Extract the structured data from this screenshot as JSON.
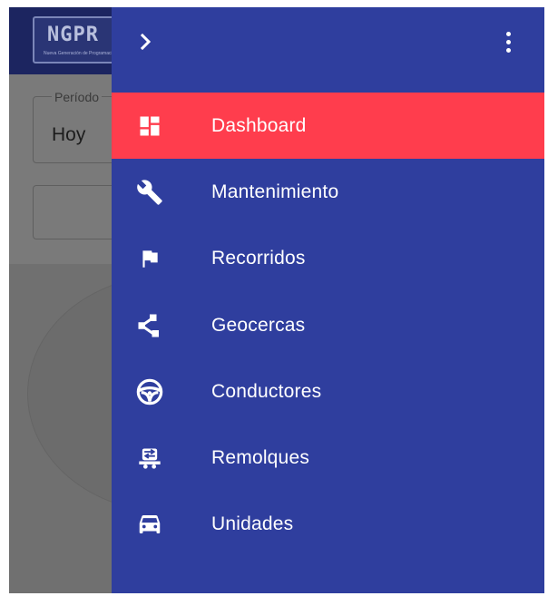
{
  "background": {
    "logo_text": "NGPR",
    "logo_subtitle": "Nueva Generación de Programación",
    "period": {
      "label": "Período",
      "value": "Hoy"
    }
  },
  "drawer": {
    "menu": [
      {
        "label": "Dashboard",
        "icon": "dashboard-icon",
        "active": true
      },
      {
        "label": "Mantenimiento",
        "icon": "wrench-icon",
        "active": false
      },
      {
        "label": "Recorridos",
        "icon": "flag-icon",
        "active": false
      },
      {
        "label": "Geocercas",
        "icon": "geofence-icon",
        "active": false
      },
      {
        "label": "Conductores",
        "icon": "steering-wheel-icon",
        "active": false
      },
      {
        "label": "Remolques",
        "icon": "trailer-icon",
        "active": false
      },
      {
        "label": "Unidades",
        "icon": "car-icon",
        "active": false
      }
    ]
  },
  "colors": {
    "drawer_bg": "#2f3e9e",
    "active_item_bg": "#ff3d4d",
    "header_bg": "#1c2560",
    "text": "#ffffff"
  }
}
